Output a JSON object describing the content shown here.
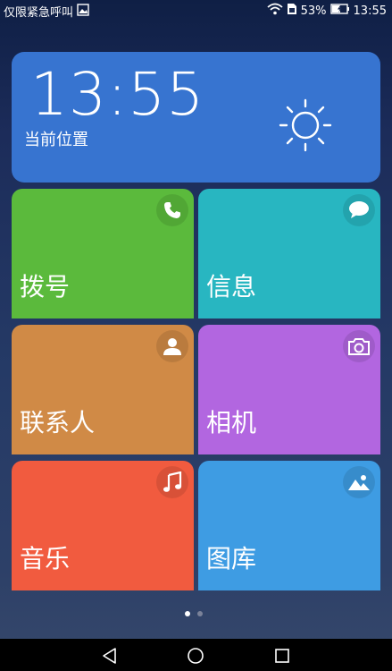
{
  "status_bar": {
    "carrier_text": "仅限紧急呼叫",
    "battery_percent": "53%",
    "time": "13:55",
    "icons": [
      "image-notification-icon",
      "wifi-icon",
      "sim-icon",
      "battery-charging-icon"
    ]
  },
  "clock_widget": {
    "time": "13:55",
    "location": "当前位置",
    "weather_icon": "sun-icon"
  },
  "tiles": [
    {
      "label": "拨号",
      "icon": "phone-icon",
      "color": "#5bba3c"
    },
    {
      "label": "信息",
      "icon": "message-icon",
      "color": "#28b6c1"
    },
    {
      "label": "联系人",
      "icon": "contact-icon",
      "color": "#d08a46"
    },
    {
      "label": "相机",
      "icon": "camera-icon",
      "color": "#b266e0"
    },
    {
      "label": "音乐",
      "icon": "music-icon",
      "color": "#f15b3f"
    },
    {
      "label": "图库",
      "icon": "gallery-icon",
      "color": "#3e9ce3"
    }
  ],
  "pager": {
    "pages": 2,
    "current": 1
  },
  "nav_bar": {
    "buttons": [
      "back-icon",
      "home-icon",
      "recents-icon"
    ]
  }
}
